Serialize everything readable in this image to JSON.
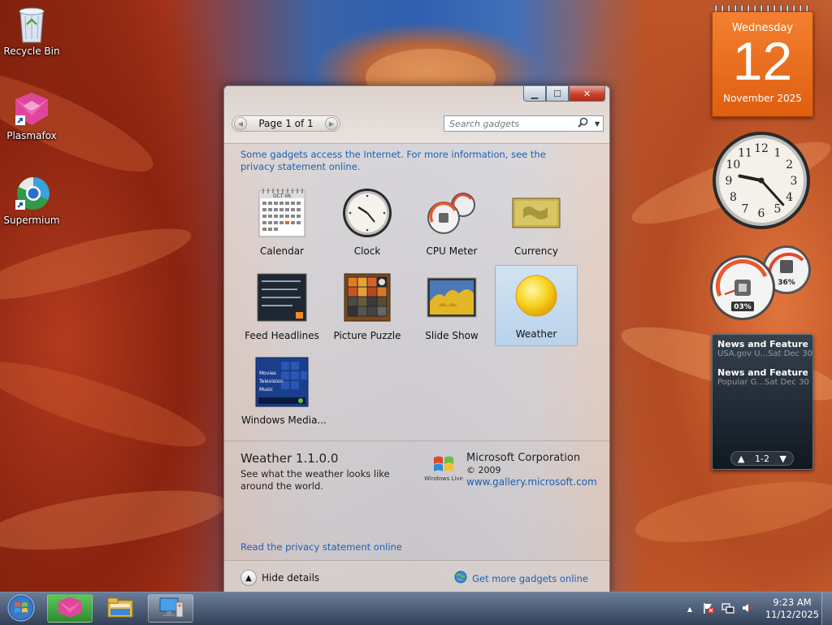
{
  "desktop": {
    "icons": [
      {
        "label": "Recycle Bin",
        "icon": "recycle-bin-icon"
      },
      {
        "label": "Plasmafox",
        "icon": "plasmafox-icon"
      },
      {
        "label": "Supermium",
        "icon": "supermium-icon"
      }
    ]
  },
  "calendar_gadget": {
    "weekday": "Wednesday",
    "day": "12",
    "month_year": "November 2025"
  },
  "clock_gadget": {
    "hour": 9,
    "minute": 23
  },
  "cpu_gadget": {
    "cpu": "03%",
    "memory": "36%"
  },
  "feed_gadget": {
    "items": [
      {
        "title": "News and Features f...",
        "source": "USA.gov U...",
        "date": "Sat Dec 30"
      },
      {
        "title": "News and Features f...",
        "source": "Popular G...",
        "date": "Sat Dec 30"
      }
    ],
    "page": "1-2"
  },
  "gallery": {
    "page_label": "Page 1 of 1",
    "search_placeholder": "Search gadgets",
    "privacy_notice": "Some gadgets access the Internet.  For more information, see the privacy statement online.",
    "gadgets": [
      {
        "label": "Calendar",
        "icon": "calendar-gadget-icon"
      },
      {
        "label": "Clock",
        "icon": "clock-gadget-icon"
      },
      {
        "label": "CPU Meter",
        "icon": "cpu-meter-gadget-icon"
      },
      {
        "label": "Currency",
        "icon": "currency-gadget-icon"
      },
      {
        "label": "Feed Headlines",
        "icon": "feed-headlines-gadget-icon"
      },
      {
        "label": "Picture Puzzle",
        "icon": "picture-puzzle-gadget-icon"
      },
      {
        "label": "Slide Show",
        "icon": "slide-show-gadget-icon"
      },
      {
        "label": "Weather",
        "icon": "weather-gadget-icon"
      },
      {
        "label": "Windows Media...",
        "icon": "windows-media-gadget-icon"
      }
    ],
    "calendar_thumb_month": "OCT 06",
    "media_thumb_lines": [
      "Movies",
      "Television",
      "Music"
    ],
    "details": {
      "title": "Weather 1.1.0.0",
      "description": "See what the weather looks like around the world.",
      "company": "Microsoft Corporation",
      "copyright": "© 2009",
      "url": "www.gallery.microsoft.com",
      "logo_text": "Windows Live"
    },
    "privacy_link": "Read the privacy statement online",
    "hide_details": "Hide details",
    "get_more": "Get more gadgets online"
  },
  "taskbar": {
    "time": "9:23 AM",
    "date": "11/12/2025",
    "tray_arrow": "▲"
  },
  "colors": {
    "link": "#1c5fb4",
    "calendar_orange": "#e86a1a",
    "selection": "#b4d2ee"
  }
}
